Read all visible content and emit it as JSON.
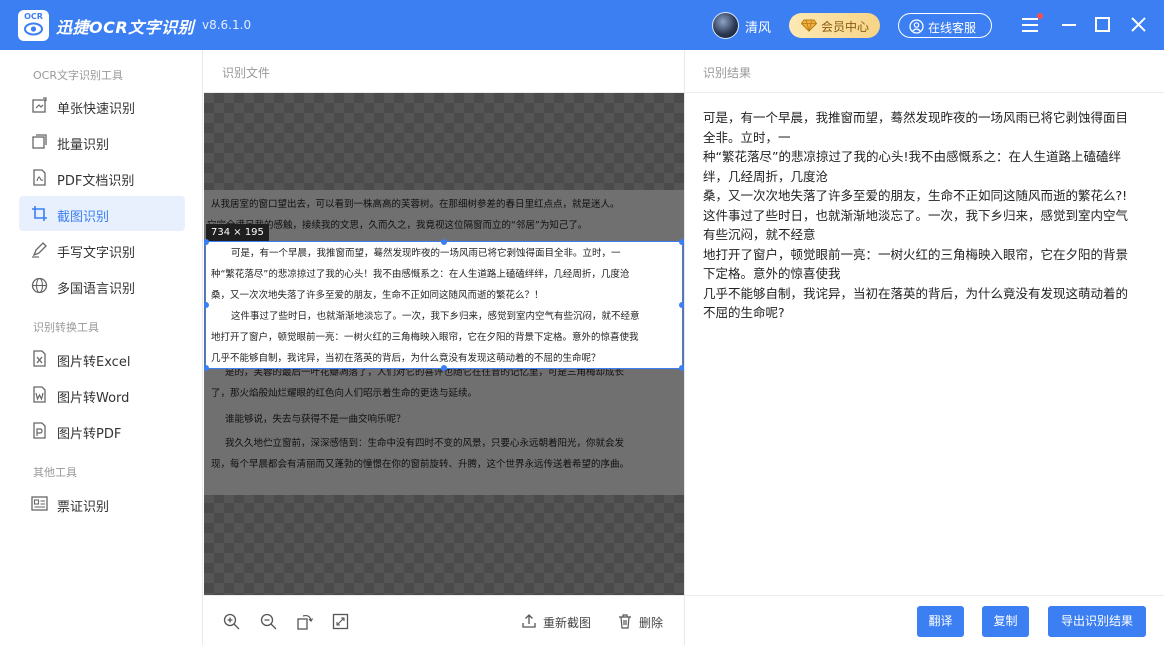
{
  "app": {
    "logo_text": "OCR",
    "title": "迅捷OCR文字识别",
    "version": "v8.6.1.0",
    "user_name": "清风",
    "vip_label": "会员中心",
    "service_label": "在线客服"
  },
  "sidebar": {
    "groups": [
      {
        "title": "OCR文字识别工具",
        "items": [
          "单张快速识别",
          "批量识别",
          "PDF文档识别",
          "截图识别",
          "手写文字识别",
          "多国语言识别"
        ]
      },
      {
        "title": "识别转换工具",
        "items": [
          "图片转Excel",
          "图片转Word",
          "图片转PDF"
        ]
      },
      {
        "title": "其他工具",
        "items": [
          "票证识别"
        ]
      }
    ],
    "active_item": "截图识别"
  },
  "left_pane": {
    "title": "识别文件",
    "selection_size": "734 × 195",
    "document": {
      "para_intro": [
        "从我居室的窗口望出去，可以看到一株高高的芙蓉树。在那细树参差的春日里红点点，就是迷人。",
        "它完全满足我的感触，接续我的文思，久而久之，我竟视这位隔窗而立的“邻居”为知己了。"
      ],
      "para_1": [
        "可是，有一个早晨，我推窗而望，蓦然发现昨夜的一场风雨已将它剥蚀得面目全非。立时，一",
        "种“繁花落尽”的悲凉掠过了我的心头！我不由感慨系之：在人生道路上磕磕绊绊，几经周折，几度沧",
        "桑，又一次次地失落了许多至爱的朋友，生命不正如同这随风而逝的繁花么？！"
      ],
      "para_2": [
        "这件事过了些时日，也就渐渐地淡忘了。一次，我下乡归来，感觉到室内空气有些沉闷，就不经意",
        "地打开了窗户，顿觉眼前一亮：一树火红的三角梅映入眼帘，它在夕阳的背景下定格。意外的惊喜使我",
        "几乎不能够自制，我诧异，当初在落英的背后，为什么竟没有发现这萌动着的不屈的生命呢？"
      ],
      "para_3": [
        "是的，芙蓉的最后一叶花瓣凋落了，人们对它的喜评也随它在往昔的记忆里，可是三角梅却成长",
        "了，那火焰般灿烂耀眼的红色向人们昭示着生命的更迭与延续。"
      ],
      "para_4": [
        "谁能够说，失去与获得不是一曲交响乐呢？"
      ],
      "para_5": [
        "我久久地伫立窗前，深深感悟到：生命中没有四时不变的风景，只要心永远朝着阳光，你就会发",
        "现，每个早晨都会有清丽而又蓬勃的憧憬在你的窗前旋转、升腾，这个世界永远传送着希望的序曲。"
      ]
    },
    "toolbar": {
      "zoom_in_icon": "zoom-in-icon",
      "zoom_out_icon": "zoom-out-icon",
      "rotate_icon": "rotate-icon",
      "fit_icon": "fit-screen-icon",
      "recapture_label": "重新截图",
      "delete_label": "删除"
    }
  },
  "right_pane": {
    "title": "识别结果",
    "result_lines": [
      "可是，有一个早晨，我推窗而望，蓦然发现昨夜的一场风雨已将它剥蚀得面目",
      "全非。立时，一",
      "种“繁花落尽”的悲凉掠过了我的心头!我不由感慨系之：在人生道路上磕磕绊",
      "绊，几经周折，几度沧",
      "桑，又一次次地失落了许多至爱的朋友，生命不正如同这随风而逝的繁花么?!",
      "这件事过了些时日，也就渐渐地淡忘了。一次，我下乡归来，感觉到室内空气",
      "有些沉闷，就不经意",
      "地打开了窗户，顿觉眼前一亮：一树火红的三角梅映入眼帘，它在夕阳的背景",
      "下定格。意外的惊喜使我",
      "几乎不能够自制，我诧异，当初在落英的背后，为什么竟没有发现这萌动着的",
      "不屈的生命呢?"
    ],
    "buttons": {
      "translate": "翻译",
      "copy": "复制",
      "export": "导出识别结果"
    }
  },
  "colors": {
    "primary": "#3b7ff3",
    "vip_gold": "#f6d486",
    "active_bg": "#e8f0fe"
  }
}
